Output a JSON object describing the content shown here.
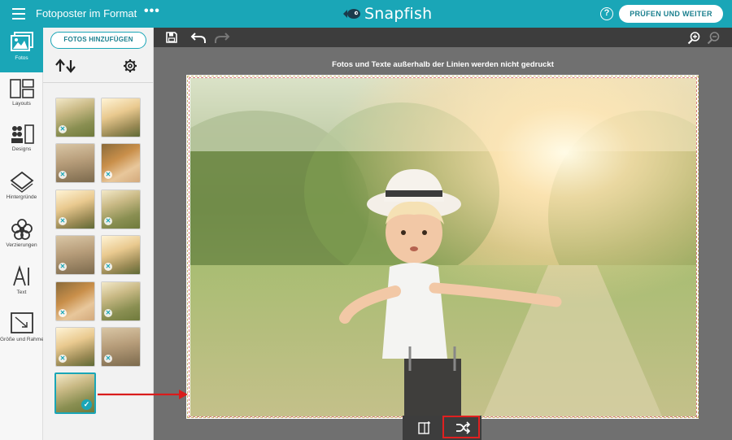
{
  "topbar": {
    "title": "Fotoposter im Format 3...",
    "more": "•••",
    "brand": "Snapfish",
    "help": "?",
    "primary_button": "PRÜFEN UND WEITER"
  },
  "rail": {
    "items": [
      {
        "label": "Fotos",
        "icon": "photos-icon"
      },
      {
        "label": "Layouts",
        "icon": "layouts-icon"
      },
      {
        "label": "Designs",
        "icon": "designs-icon"
      },
      {
        "label": "Hintergründe",
        "icon": "backgrounds-icon"
      },
      {
        "label": "Verzierungen",
        "icon": "embellishments-icon"
      },
      {
        "label": "Text",
        "icon": "text-icon"
      },
      {
        "label": "Größe und Rahmen",
        "icon": "size-frame-icon"
      }
    ]
  },
  "panel": {
    "add_button": "FOTOS HINZUFÜGEN",
    "sort_icon": "sort-arrows-icon",
    "settings_icon": "gear-icon",
    "thumbnails": [
      {
        "state": "used"
      },
      {
        "state": "none"
      },
      {
        "state": "used"
      },
      {
        "state": "used"
      },
      {
        "state": "used"
      },
      {
        "state": "used"
      },
      {
        "state": "used"
      },
      {
        "state": "used"
      },
      {
        "state": "used"
      },
      {
        "state": "used"
      },
      {
        "state": "used"
      },
      {
        "state": "used"
      },
      {
        "state": "selected"
      }
    ]
  },
  "toolbar": {
    "save_icon": "save-icon",
    "undo_icon": "undo-icon",
    "redo_icon": "redo-icon",
    "zoom_in_icon": "zoom-in-icon",
    "zoom_out_icon": "zoom-out-icon"
  },
  "canvas": {
    "notice": "Fotos und Texte außerhalb der Linien werden nicht gedruckt"
  },
  "photo_tools": {
    "left_icon": "replace-photo-icon",
    "right_icon": "shuffle-icon"
  },
  "colors": {
    "accent": "#1aa6b7",
    "highlight": "#e02020",
    "toolbar": "#3d3d3d"
  }
}
